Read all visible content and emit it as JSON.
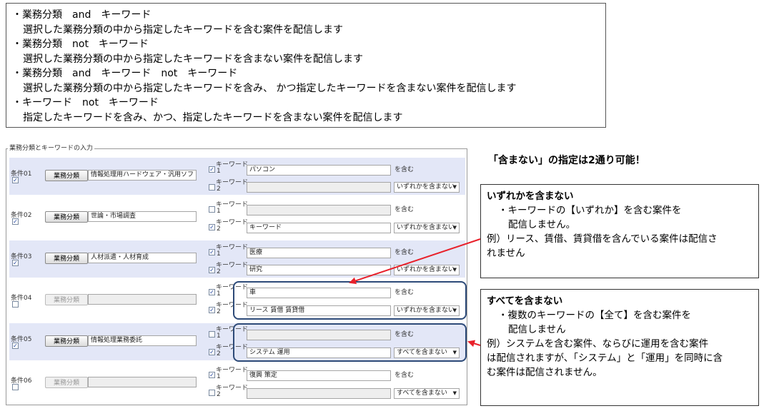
{
  "rules": [
    {
      "head": "・業務分類　and　キーワード",
      "desc": "選択した業務分類の中から指定したキーワードを含む案件を配信します"
    },
    {
      "head": "・業務分類　not　キーワード",
      "desc": "選択した業務分類の中から指定したキーワードを含まない案件を配信します"
    },
    {
      "head": "・業務分類　and　キーワード　not　キーワード",
      "desc": "選択した業務分類の中から指定したキーワードを含み、 かつ指定したキーワードを含まない案件を配信します"
    },
    {
      "head": "・キーワード　not　キーワード",
      "desc": "指定したキーワードを含み、かつ、指定したキーワードを含まない案件を配信します"
    }
  ],
  "form": {
    "legend": "業務分類とキーワードの入力",
    "gyomu_button": "業務分類",
    "keyword_label": "キーワード",
    "num1": "1",
    "num2": "2",
    "contains": "を含む",
    "conditions": [
      {
        "label": "条件01",
        "gyomu": "情報処理用ハードウェア・汎用ソフトウェ",
        "kw1": "パソコン",
        "kw2": "",
        "not_option": "いずれかを含まない"
      },
      {
        "label": "条件02",
        "gyomu": "世論・市場調査",
        "kw1": "",
        "kw2": "キーワード",
        "not_option": "いずれかを含まない"
      },
      {
        "label": "条件03",
        "gyomu": "人材派遣・人材育成",
        "kw1": "医療",
        "kw2": "研究",
        "not_option": "いずれかを含まない"
      },
      {
        "label": "条件04",
        "gyomu": "",
        "kw1": "車",
        "kw2": "リース 賃借 賃貸借",
        "not_option": "いずれかを含まない"
      },
      {
        "label": "条件05",
        "gyomu": "情報処理業務委託",
        "kw1": "",
        "kw2": "システム 運用",
        "not_option": "すべてを含まない"
      },
      {
        "label": "条件06",
        "gyomu": "",
        "kw1": "復興 策定",
        "kw2": "",
        "not_option": "すべてを含まない"
      }
    ]
  },
  "notes": {
    "top": "「含まない」の指定は2通り可能！",
    "any": {
      "title": "いずれかを含まない",
      "line1": "・キーワードの【いずれか】を含む案件を",
      "line2": "配信しません。",
      "example1": "例）リース、賃借、賃貸借を含んでいる案件は配信さ",
      "example2": "れません"
    },
    "all": {
      "title": "すべてを含まない",
      "line1": "・複数のキーワードの【全て】を含む案件を",
      "line2": "配信しません",
      "example1": "例）システムを含む案件、ならびに運用を含む案件",
      "example2": "は配信されますが、「システム」と「運用」を同時に含",
      "example3": "む案件は配信されません。"
    }
  },
  "colors": {
    "row_shade": "#e3e7f7",
    "highlight": "#2d4a78",
    "arrow": "#e8202a"
  }
}
